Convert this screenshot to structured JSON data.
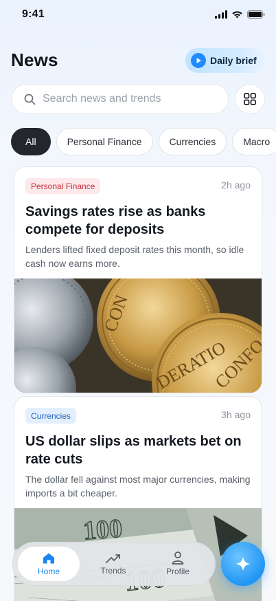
{
  "status": {
    "time": "9:41"
  },
  "header": {
    "title": "News",
    "daily_brief_label": "Daily brief"
  },
  "search": {
    "placeholder": "Search news and trends",
    "value": ""
  },
  "categories": [
    "All",
    "Personal Finance",
    "Currencies",
    "Macro"
  ],
  "active_category": "All",
  "articles": [
    {
      "tag": "Personal Finance",
      "time": "2h ago",
      "headline": "Savings rates rise as banks compete for deposits",
      "summary": "Lenders lifted fixed deposit rates this month, so idle cash now earns more.",
      "image": "gold-coins-photo"
    },
    {
      "tag": "Currencies",
      "time": "3h ago",
      "headline": "US dollar slips as markets bet on rate cuts",
      "summary": "The dollar fell against most major currencies, making imports a bit cheaper.",
      "image": "hundred-dollar-bills-photo"
    }
  ],
  "coin_lettering": [
    "CON",
    "DERATIO",
    "CONFO"
  ],
  "banknote_lettering": [
    "100",
    "100"
  ],
  "tab_bar": {
    "items": [
      {
        "label": "Home",
        "icon": "home-icon",
        "active": true
      },
      {
        "label": "Trends",
        "icon": "trend-up-icon",
        "active": false
      },
      {
        "label": "Profile",
        "icon": "person-icon",
        "active": false
      }
    ]
  },
  "fab_icon": "sparkle-icon",
  "colors": {
    "accent": "#1a84f0",
    "tag_personal_finance_bg": "#fde8ea",
    "tag_personal_finance_text": "#c8303c",
    "tag_currencies_bg": "#e3effd",
    "tag_currencies_text": "#2366c4",
    "active_chip": "#23262b"
  }
}
